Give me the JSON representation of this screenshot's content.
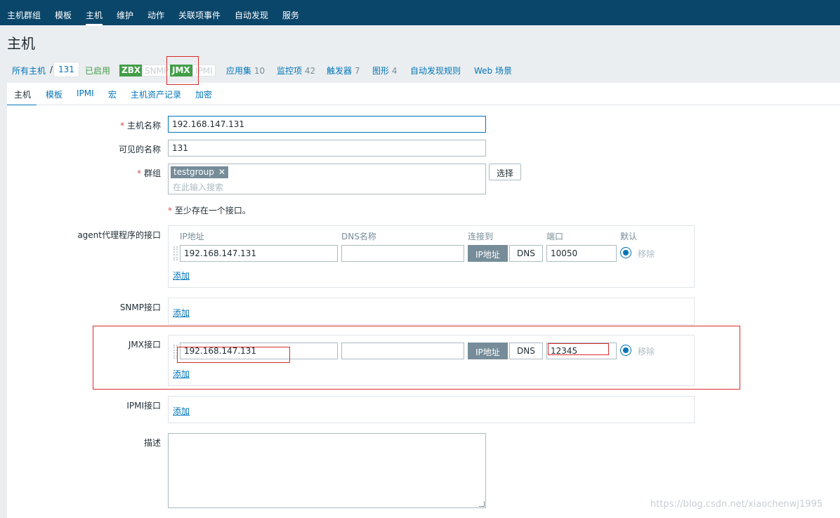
{
  "topnav": {
    "items": [
      "主机群组",
      "模板",
      "主机",
      "维护",
      "动作",
      "关联项事件",
      "自动发现",
      "服务"
    ],
    "active_index": 2
  },
  "page_title": "主机",
  "hostnav": {
    "all_hosts": "所有主机",
    "separator": "/",
    "host": "131",
    "enabled": "已启用",
    "badges": [
      {
        "label": "ZBX",
        "state": "on"
      },
      {
        "label": "SNMP",
        "state": "off"
      },
      {
        "label": "JMX",
        "state": "on"
      },
      {
        "label": "IPMI",
        "state": "off"
      }
    ],
    "links": [
      {
        "label": "应用集",
        "count": "10"
      },
      {
        "label": "监控项",
        "count": "42"
      },
      {
        "label": "触发器",
        "count": "7"
      },
      {
        "label": "图形",
        "count": "4"
      },
      {
        "label": "自动发现规则",
        "count": ""
      },
      {
        "label": "Web 场景",
        "count": ""
      }
    ]
  },
  "subtabs": [
    "主机",
    "模板",
    "IPMI",
    "宏",
    "主机资产记录",
    "加密"
  ],
  "form": {
    "required_mark": "*",
    "hostname_label": "主机名称",
    "hostname_value": "192.168.147.131",
    "visible_name_label": "可见的名称",
    "visible_name_value": "131",
    "groups_label": "群组",
    "group_tag": "testgroup",
    "tag_remove": "✕",
    "groups_placeholder": "在此输入搜索",
    "select_button": "选择",
    "interface_note": "至少存在一个接口。",
    "columns": {
      "ip": "IP地址",
      "dns": "DNS名称",
      "connect_to": "连接到",
      "port": "端口",
      "default": "默认"
    },
    "agent": {
      "label": "agent代理程序的接口",
      "ip": "192.168.147.131",
      "dns": "",
      "port": "10050"
    },
    "snmp": {
      "label": "SNMP接口"
    },
    "jmx": {
      "label": "JMX接口",
      "ip": "192.168.147.131",
      "dns": "",
      "port": "12345"
    },
    "ipmi": {
      "label": "IPMI接口"
    },
    "connect_ip": "IP地址",
    "connect_dns": "DNS",
    "remove_label": "移除",
    "add_label": "添加",
    "description_label": "描述",
    "description_value": ""
  },
  "colors": {
    "header_bg": "#0a466a",
    "link": "#0275b8",
    "enabled_green": "#429e47",
    "annotation_red": "#d92c2c"
  },
  "watermark": "https://blog.csdn.net/xiaochenwj1995"
}
